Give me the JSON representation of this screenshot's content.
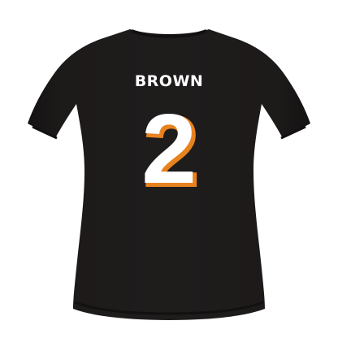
{
  "jersey": {
    "name": "BROWN",
    "number": "2",
    "colors": {
      "shirt": "#1b1818",
      "shirt_shadow": "#121010",
      "text": "#ffffff",
      "trim": "#e8821e",
      "background": "#ffffff"
    }
  }
}
